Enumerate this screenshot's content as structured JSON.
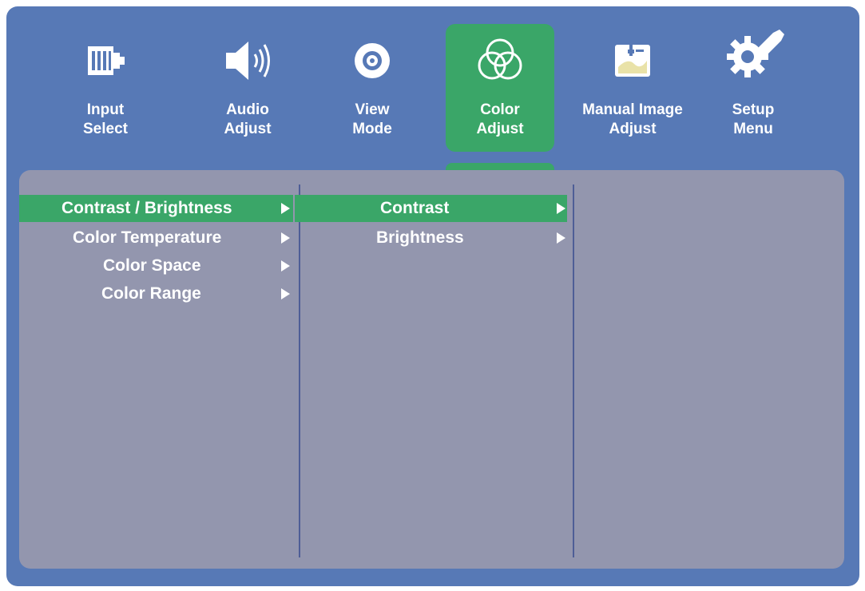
{
  "tabs": [
    {
      "id": "input-select",
      "line1": "Input",
      "line2": "Select",
      "icon": "input-connector-icon"
    },
    {
      "id": "audio-adjust",
      "line1": "Audio",
      "line2": "Adjust",
      "icon": "speaker-icon"
    },
    {
      "id": "view-mode",
      "line1": "View",
      "line2": "Mode",
      "icon": "eye-icon"
    },
    {
      "id": "color-adjust",
      "line1": "Color",
      "line2": "Adjust",
      "icon": "color-circles-icon",
      "active": true
    },
    {
      "id": "manual-image-adjust",
      "line1": "Manual Image",
      "line2": "Adjust",
      "icon": "image-adjust-icon"
    },
    {
      "id": "setup-menu",
      "line1": "Setup",
      "line2": "Menu",
      "icon": "gear-wrench-icon"
    }
  ],
  "menu": {
    "col1": [
      {
        "label": "Contrast / Brightness",
        "selected": true
      },
      {
        "label": "Color Temperature"
      },
      {
        "label": "Color Space"
      },
      {
        "label": "Color Range"
      }
    ],
    "col2": [
      {
        "label": "Contrast",
        "selected": true
      },
      {
        "label": "Brightness"
      }
    ]
  },
  "colors": {
    "frame": "#5779b6",
    "panel": "#9396ae",
    "active": "#3aa668",
    "divider": "#4e5e96",
    "text": "#ffffff"
  }
}
